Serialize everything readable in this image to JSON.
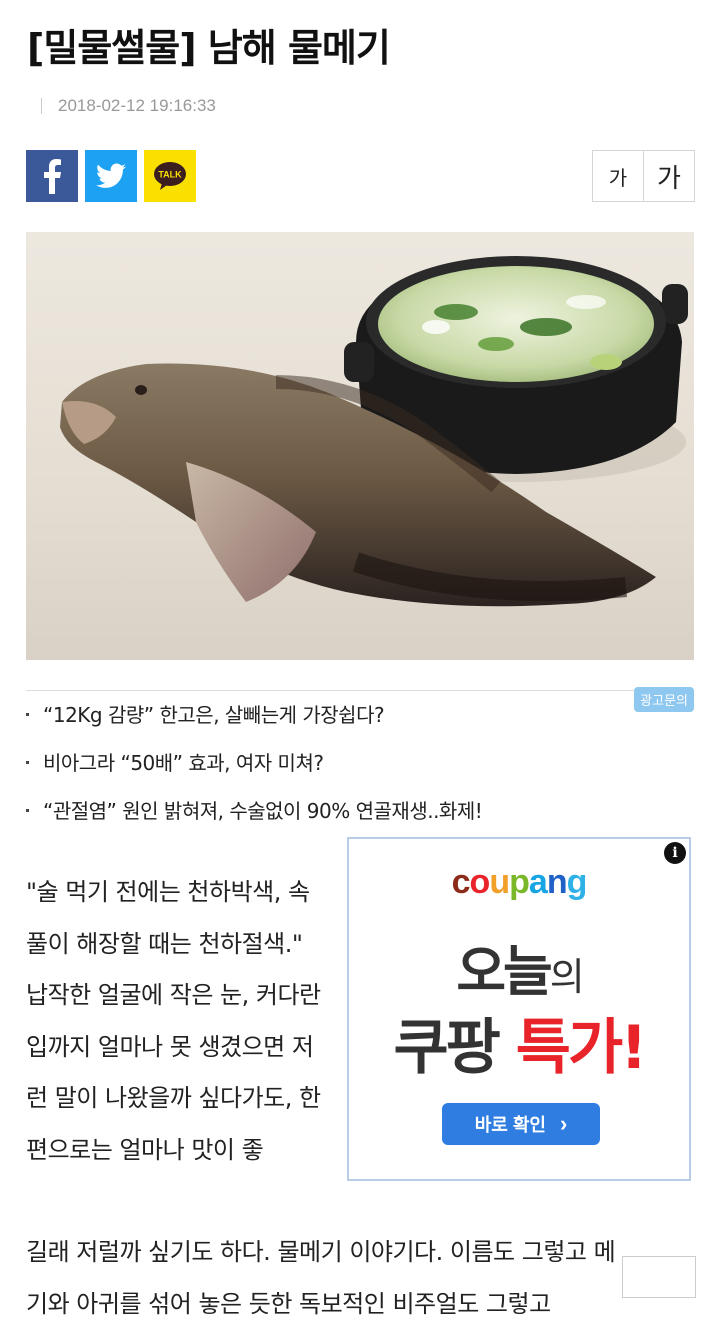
{
  "article": {
    "title": "[밀물썰물] 남해 물메기",
    "date": "2018-02-12 19:16:33",
    "body_narrow": "\"술 먹기 전에는 천하박색, 속풀이 해장할 때는 천하절색.\" 납작한 얼굴에 작은 눈, 커다란 입까지 얼마나 못 생겼으면 저런 말이 나왔을까 싶다가도, 한편으로는 얼마나 맛이 좋",
    "body_wide_1": "길래 저럴까 싶기도 하다. 물메기 이야기다. 이름도 그렇고 메",
    "body_wide_2": "기와 아귀를 섞어 놓은 듯한 독보적인 비주얼도 그렇고"
  },
  "share": {
    "facebook_icon": "facebook-icon",
    "twitter_icon": "twitter-icon",
    "kakao_icon": "kakaotalk-icon",
    "kakao_label": "TALK",
    "colors": {
      "facebook": "#3b5998",
      "twitter": "#1da1f2",
      "kakao": "#f9e000"
    }
  },
  "font_size": {
    "small_label": "가",
    "large_label": "가"
  },
  "ad_links": {
    "tag": "광고문의",
    "items": [
      "“12Kg 감량” 한고은, 살빼는게 가장쉽다?",
      "비아그라 “50배” 효과, 여자 미쳐?",
      "“관절염” 원인 밝혀져, 수술없이 90% 연골재생..화제!"
    ]
  },
  "coupang_ad": {
    "info_icon": "i",
    "logo": [
      "c",
      "o",
      "u",
      "p",
      "a",
      "n",
      "g"
    ],
    "logo_colors": [
      "#8c2b1a",
      "#e8242a",
      "#f3a02b",
      "#7ab829",
      "#17a5e4",
      "#1f61c7",
      "#2db1e6"
    ],
    "headline_main": "오늘",
    "headline_suffix": "의",
    "headline2_dark": "쿠팡 ",
    "headline2_red": "특가!",
    "button_label": "바로 확인",
    "button_arrow": "›",
    "accent": "#2f7de1"
  }
}
